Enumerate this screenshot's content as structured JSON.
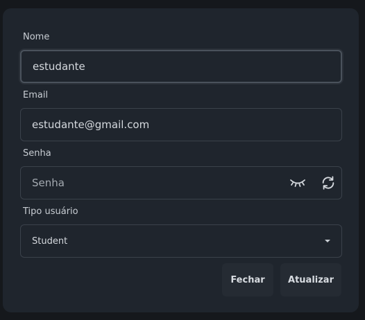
{
  "form": {
    "name": {
      "label": "Nome",
      "value": "estudante"
    },
    "email": {
      "label": "Email",
      "value": "estudante@gmail.com"
    },
    "password": {
      "label": "Senha",
      "placeholder": "Senha",
      "value": ""
    },
    "user_type": {
      "label": "Tipo usuário",
      "selected": "Student"
    }
  },
  "icons": {
    "toggle_visibility": "eye-closed-icon",
    "generate_password": "refresh-icon",
    "dropdown": "caret-down-icon"
  },
  "actions": {
    "close_label": "Fechar",
    "update_label": "Atualizar"
  },
  "colors": {
    "background": "#15181c",
    "panel": "#1f252d",
    "input_border": "#3b424b",
    "button_bg": "#252b33",
    "text": "#d5d9de"
  }
}
